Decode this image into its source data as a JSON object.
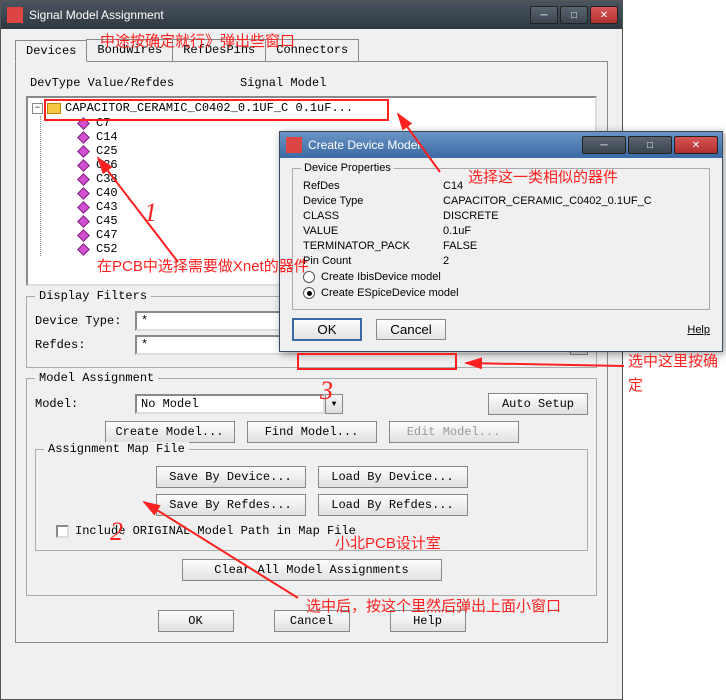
{
  "main_window": {
    "title": "Signal Model Assignment",
    "tabs": [
      "Devices",
      "BondWires",
      "RefDesPins",
      "Connectors"
    ],
    "active_tab": 0,
    "col_header_left": "DevType Value/Refdes",
    "col_header_right": "Signal Model",
    "tree_root": "CAPACITOR_CERAMIC_C0402_0.1UF_C 0.1uF...",
    "tree_items": [
      "C7",
      "C14",
      "C25",
      "C36",
      "C38",
      "C40",
      "C43",
      "C45",
      "C47",
      "C52"
    ],
    "display_filters": {
      "legend": "Display Filters",
      "device_type_label": "Device Type:",
      "device_type_value": "*",
      "refdes_label": "Refdes:",
      "refdes_value": "*"
    },
    "model_assignment": {
      "legend": "Model Assignment",
      "model_label": "Model:",
      "model_value": "No Model",
      "auto_setup": "Auto Setup",
      "create_model": "Create Model...",
      "find_model": "Find Model...",
      "edit_model": "Edit Model...",
      "map_legend": "Assignment Map File",
      "save_by_device": "Save By Device...",
      "load_by_device": "Load By Device...",
      "save_by_refdes": "Save By Refdes...",
      "load_by_refdes": "Load By Refdes...",
      "include_label": "Include ORIGINAL Model Path in Map File",
      "clear_all": "Clear All Model Assignments"
    },
    "bottom": {
      "ok": "OK",
      "cancel": "Cancel",
      "help": "Help"
    }
  },
  "dialog": {
    "title": "Create Device Model",
    "group_legend": "Device Properties",
    "props": [
      {
        "k": "RefDes",
        "v": "C14"
      },
      {
        "k": "Device Type",
        "v": "CAPACITOR_CERAMIC_C0402_0.1UF_C"
      },
      {
        "k": "CLASS",
        "v": "DISCRETE"
      },
      {
        "k": "VALUE",
        "v": "0.1uF"
      },
      {
        "k": "TERMINATOR_PACK",
        "v": "FALSE"
      },
      {
        "k": "Pin Count",
        "v": "2"
      }
    ],
    "radio_ibis": "Create IbisDevice model",
    "radio_espice": "Create ESpiceDevice model",
    "ok": "OK",
    "cancel": "Cancel",
    "help": "Help"
  },
  "annotations": {
    "a1": "中途按确定就行》弹出些窗口",
    "a2": "选择这一类相似的器件",
    "a3": "在PCB中选择需要做Xnet的器件",
    "a4": "选中这里按确定",
    "a5": "小北PCB设计室",
    "a6": "选中后，按这个里然后弹出上面小窗口",
    "n1": "1",
    "n2": "2",
    "n3": "3"
  },
  "colors": {
    "anno_red": "#ff2020"
  }
}
